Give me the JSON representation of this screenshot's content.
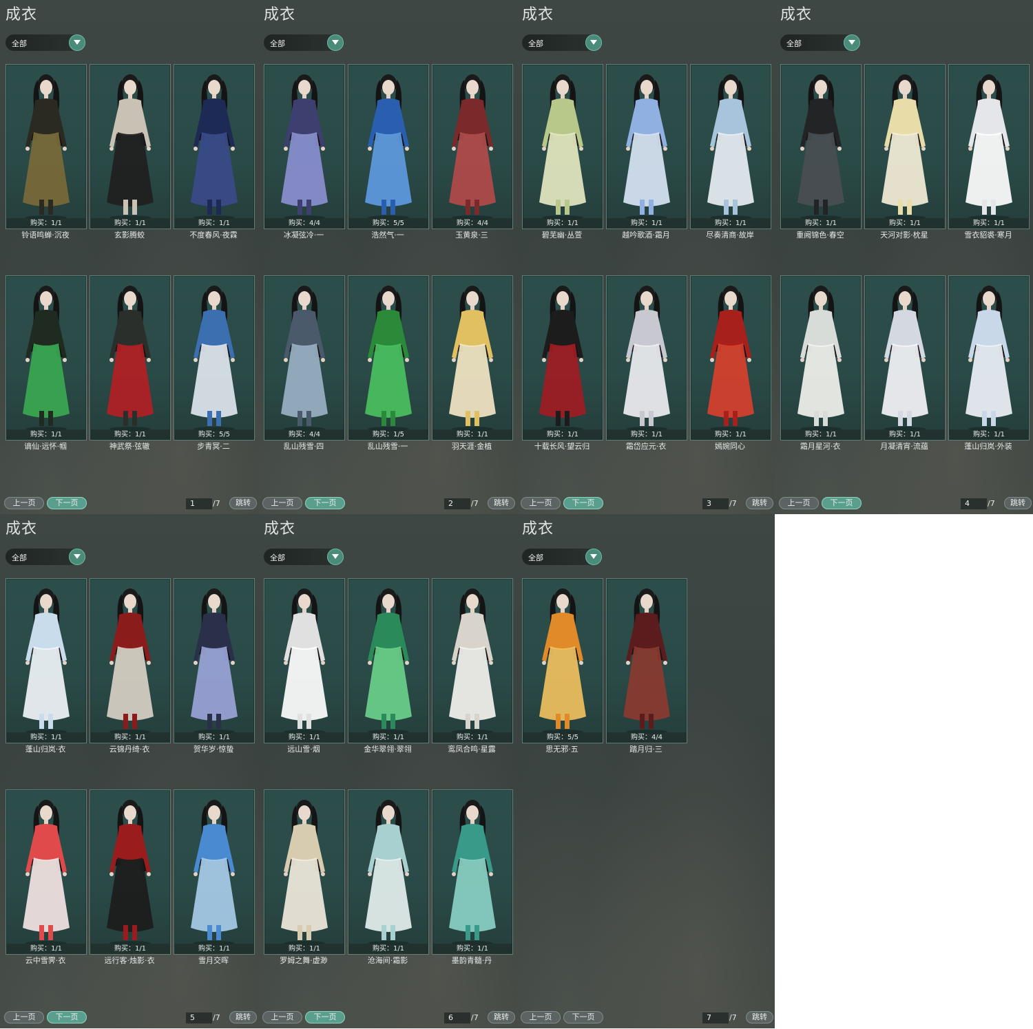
{
  "colors": {
    "panel_bg": "#3d4543",
    "card_bg": "#2b4c49",
    "accent": "#5a9f8d"
  },
  "panels": [
    {
      "title": "成衣",
      "filter": "全部",
      "pager": {
        "prev": "上一页",
        "next": "下一页",
        "page": "1",
        "total": "/7",
        "jump": "跳转"
      },
      "items": [
        {
          "buy": "购买：1/1",
          "name": "铃语鸣蝉·沉夜",
          "c1": "#2a2a22",
          "c2": "#7a6a3a"
        },
        {
          "buy": "购买：1/1",
          "name": "玄影腾蛟",
          "c1": "#c9c2b4",
          "c2": "#1f1f1f"
        },
        {
          "buy": "购买：1/1",
          "name": "不度春风·夜霖",
          "c1": "#1c2a55",
          "c2": "#3a4a8a"
        },
        {
          "buy": "购买：1/1",
          "name": "谪仙·远怀·帼",
          "c1": "#1f2b20",
          "c2": "#3aa850"
        },
        {
          "buy": "购买：1/1",
          "name": "神武祭·弦辙",
          "c1": "#2a2f2b",
          "c2": "#b21f24"
        },
        {
          "buy": "购买：5/5",
          "name": "步青冥·二",
          "c1": "#3c6fb0",
          "c2": "#dfe6ee"
        }
      ]
    },
    {
      "title": "成衣",
      "filter": "全部",
      "pager": {
        "prev": "上一页",
        "next": "下一页",
        "page": "2",
        "total": "/7",
        "jump": "跳转"
      },
      "items": [
        {
          "buy": "购买：4/4",
          "name": "冰凝弦冷·一",
          "c1": "#3d3f6e",
          "c2": "#8a8fd0"
        },
        {
          "buy": "购买：5/5",
          "name": "浩然气·一",
          "c1": "#2a5fb0",
          "c2": "#5e9ae0"
        },
        {
          "buy": "购买：4/4",
          "name": "玉黄泉·三",
          "c1": "#7a2a2a",
          "c2": "#b24a4a"
        },
        {
          "buy": "购买：4/4",
          "name": "乱山残雪·四",
          "c1": "#4a5a6a",
          "c2": "#9ab0c4"
        },
        {
          "buy": "购买：1/5",
          "name": "乱山残雪·一",
          "c1": "#2a8a3a",
          "c2": "#4ac060"
        },
        {
          "buy": "购买：1/1",
          "name": "羽天涯·金植",
          "c1": "#e0c060",
          "c2": "#f3e6c4"
        }
      ]
    },
    {
      "title": "成衣",
      "filter": "全部",
      "pager": {
        "prev": "上一页",
        "next": "下一页",
        "page": "3",
        "total": "/7",
        "jump": "跳转"
      },
      "items": [
        {
          "buy": "购买：1/1",
          "name": "碧芜幽·丛萱",
          "c1": "#b8c88a",
          "c2": "#e4e8c0"
        },
        {
          "buy": "购买：1/1",
          "name": "越吟歌酒·霜月",
          "c1": "#8fb0e0",
          "c2": "#d8e4f4"
        },
        {
          "buy": "购买：1/1",
          "name": "尽奏清商·故岸",
          "c1": "#a8c4dc",
          "c2": "#e8eef4"
        },
        {
          "buy": "购买：1/1",
          "name": "十载长风·望云归",
          "c1": "#1c1c1c",
          "c2": "#a01c24"
        },
        {
          "buy": "购买：1/1",
          "name": "霜岱应元·衣",
          "c1": "#c8c8d0",
          "c2": "#eeeef2"
        },
        {
          "buy": "购买：1/1",
          "name": "嫣婉同心",
          "c1": "#a8201c",
          "c2": "#d8402c"
        }
      ]
    },
    {
      "title": "成衣",
      "filter": "全部",
      "pager": {
        "prev": "上一页",
        "next": "下一页",
        "page": "4",
        "total": "/7",
        "jump": "跳转"
      },
      "items": [
        {
          "buy": "购买：1/1",
          "name": "重阙锦色·春空",
          "c1": "#222426",
          "c2": "#4a4e52"
        },
        {
          "buy": "购买：1/1",
          "name": "天河对影·枕星",
          "c1": "#e8dca8",
          "c2": "#f4eed8"
        },
        {
          "buy": "购买：1/1",
          "name": "雪衣貂裘·寒月",
          "c1": "#e4e6ea",
          "c2": "#ffffff"
        },
        {
          "buy": "购买：1/1",
          "name": "霜月星河·衣",
          "c1": "#d8dcd8",
          "c2": "#f2f2ee"
        },
        {
          "buy": "购买：1/1",
          "name": "月凝清宵·流蕴",
          "c1": "#d4d8e0",
          "c2": "#f4f4f8"
        },
        {
          "buy": "购买：1/1",
          "name": "蓬山归岚·外装",
          "c1": "#c8d8e8",
          "c2": "#eef2f8"
        }
      ]
    },
    {
      "title": "成衣",
      "filter": "全部",
      "pager": {
        "prev": "上一页",
        "next": "下一页",
        "page": "5",
        "total": "/7",
        "jump": "跳转"
      },
      "items": [
        {
          "buy": "购买：1/1",
          "name": "蓬山归岚·衣",
          "c1": "#c8dceb",
          "c2": "#f0f4f8"
        },
        {
          "buy": "购买：1/1",
          "name": "云锦丹绮·衣",
          "c1": "#8a1c1c",
          "c2": "#d8d0c4"
        },
        {
          "buy": "购买：1/1",
          "name": "贺华岁·惊蛰",
          "c1": "#2a2f4a",
          "c2": "#9aa4d8"
        },
        {
          "buy": "购买：1/1",
          "name": "云中雪霁·衣",
          "c1": "#e04a4a",
          "c2": "#f4e4e4"
        },
        {
          "buy": "购买：1/1",
          "name": "远行客·烛影·衣",
          "c1": "#9a1c1c",
          "c2": "#1c1c1c"
        },
        {
          "buy": "购买：1/1",
          "name": "雪月交晖",
          "c1": "#4a8ad0",
          "c2": "#a8cce8"
        }
      ]
    },
    {
      "title": "成衣",
      "filter": "全部",
      "pager": {
        "prev": "上一页",
        "next": "下一页",
        "page": "6",
        "total": "/7",
        "jump": "跳转"
      },
      "items": [
        {
          "buy": "购买：1/1",
          "name": "远山雪·烟",
          "c1": "#e0e0e0",
          "c2": "#ffffff"
        },
        {
          "buy": "购买：1/1",
          "name": "金华翠翎·翠翎",
          "c1": "#2a8a5a",
          "c2": "#6ad08a"
        },
        {
          "buy": "购买：1/1",
          "name": "鸾凤合鸣·星露",
          "c1": "#d8d4cc",
          "c2": "#f4f2ee"
        },
        {
          "buy": "购买：1/1",
          "name": "罗姆之舞·虚渺",
          "c1": "#d8ccb0",
          "c2": "#f0eadc"
        },
        {
          "buy": "购买：1/1",
          "name": "沧海间·霜影",
          "c1": "#a8d0d0",
          "c2": "#e4f0ee"
        },
        {
          "buy": "购买：1/1",
          "name": "墨韵青髓·丹",
          "c1": "#3a9a8a",
          "c2": "#8ad0c4"
        }
      ]
    },
    {
      "title": "成衣",
      "filter": "全部",
      "pager": {
        "prev": "上一页",
        "next": "下一页",
        "page": "7",
        "total": "/7",
        "jump": "跳转"
      },
      "items": [
        {
          "buy": "购买：5/5",
          "name": "思无邪·五",
          "c1": "#e08a2a",
          "c2": "#f0c060"
        },
        {
          "buy": "购买：4/4",
          "name": "踏月归·三",
          "c1": "#5a1c1c",
          "c2": "#8a3a30"
        }
      ]
    }
  ]
}
